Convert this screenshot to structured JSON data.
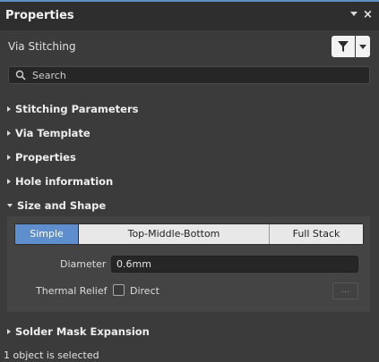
{
  "window": {
    "title": "Properties"
  },
  "header": {
    "subtitle": "Via Stitching"
  },
  "search": {
    "placeholder": "Search"
  },
  "sections": {
    "stitching_parameters": "Stitching Parameters",
    "via_template": "Via Template",
    "properties": "Properties",
    "hole_information": "Hole information",
    "size_and_shape": "Size and Shape",
    "solder_mask_expansion": "Solder Mask Expansion"
  },
  "size_shape": {
    "tabs": [
      "Simple",
      "Top-Middle-Bottom",
      "Full Stack"
    ],
    "selected_tab": "Simple",
    "diameter_label": "Diameter",
    "diameter_value": "0.6mm",
    "thermal_label": "Thermal Relief",
    "direct_label": "Direct",
    "direct_checked": false,
    "ellipsis": "..."
  },
  "status": {
    "text": "1 object is selected"
  },
  "colors": {
    "accent": "#5e8ecb",
    "title_bar_border": "#5d8fc7",
    "background": "#3b3b3b"
  },
  "icons": [
    "pin-dropdown-icon",
    "close-icon",
    "filter-icon",
    "chevron-down-icon",
    "search-icon",
    "expand-arrow-icon"
  ]
}
